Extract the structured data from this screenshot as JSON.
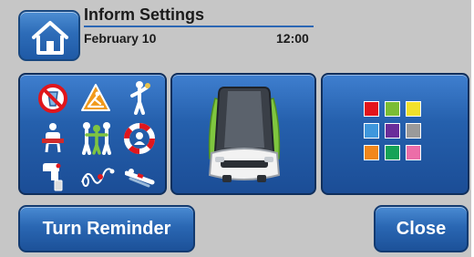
{
  "header": {
    "title": "Inform Settings",
    "date": "February 10",
    "time": "12:00",
    "home_icon": "home-icon"
  },
  "tiles": {
    "alerts": {
      "icons": [
        "no-fluids-icon",
        "wet-floor-warning-icon",
        "standing-person-icon",
        "patient-assist-icon",
        "two-person-assist-icon",
        "lifebuoy-icon",
        "hand-device-icon",
        "call-cord-icon",
        "bed-rail-icon"
      ]
    },
    "bed": {
      "icon": "hospital-bed-icon"
    },
    "colors": {
      "swatches": [
        "#e3141c",
        "#7bbd35",
        "#f2e12b",
        "#3f97dc",
        "#6a2d9a",
        "#9a9a9a",
        "#f2871b",
        "#15a356",
        "#ec6da8"
      ]
    }
  },
  "buttons": {
    "turn_reminder": "Turn Reminder",
    "close": "Close"
  },
  "colors": {
    "background": "#c6c6c6",
    "button_blue": "#2a67b3",
    "accent_rule": "#2b67b4"
  }
}
